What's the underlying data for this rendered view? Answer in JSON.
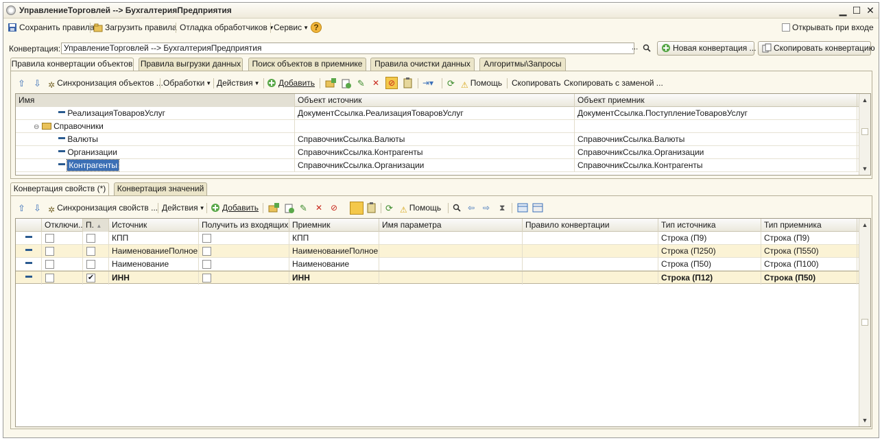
{
  "window": {
    "title": "УправлениеТорговлей --> БухгалтерияПредприятия",
    "minimize": "▁",
    "maximize": "☐",
    "close": "✕"
  },
  "toolbar": {
    "save_rules": "Сохранить правила",
    "load_rules": "Загрузить правила",
    "debug_handlers": "Отладка обработчиков",
    "service": "Сервис",
    "help_icon": "?",
    "open_on_login": "Открывать при входе"
  },
  "conversion": {
    "label": "Конвертация:",
    "value": "УправлениеТорговлей --> БухгалтерияПредприятия",
    "ellipsis": "...",
    "new_button": "Новая конвертация ...",
    "copy_button": "Скопировать конвертацию"
  },
  "top_tabs": [
    "Правила конвертации объектов",
    "Правила выгрузки данных",
    "Поиск объектов в приемнике",
    "Правила очистки данных",
    "Алгоритмы\\Запросы"
  ],
  "top_toolbar": {
    "sync": "Синхронизация объектов ...",
    "processing": "Обработки",
    "actions": "Действия",
    "add": "Добавить",
    "help": "Помощь",
    "copy": "Скопировать",
    "copy_replace": "Скопировать с заменой ..."
  },
  "top_grid": {
    "columns": [
      "Имя",
      "Объект источник",
      "Объект приемник"
    ],
    "rows": [
      {
        "name": "РеализацияТоваровУслуг",
        "source": "ДокументСсылка.РеализацияТоваровУслуг",
        "target": "ДокументСсылка.ПоступлениеТоваровУслуг"
      },
      {
        "name": "Справочники",
        "source": "",
        "target": ""
      },
      {
        "name": "Валюты",
        "source": "СправочникСсылка.Валюты",
        "target": "СправочникСсылка.Валюты"
      },
      {
        "name": "Организации",
        "source": "СправочникСсылка.Контрагенты",
        "target": "СправочникСсылка.Организации"
      },
      {
        "name": "Контрагенты",
        "source": "СправочникСсылка.Организации",
        "target": "СправочникСсылка.Контрагенты"
      }
    ]
  },
  "bottom_tabs": [
    "Конвертация свойств (*)",
    "Конвертация значений"
  ],
  "bottom_toolbar": {
    "sync": "Синхронизация свойств ...",
    "actions": "Действия",
    "add": "Добавить",
    "help": "Помощь"
  },
  "prop_grid": {
    "columns": [
      "Отключи...",
      "П.",
      "Источник",
      "Получить из входящих ...",
      "Приемник",
      "Имя параметра",
      "Правило конвертации",
      "Тип источника",
      "Тип приемника"
    ],
    "rows": [
      {
        "disabled": false,
        "p": false,
        "source": "КПП",
        "incoming": false,
        "target": "КПП",
        "param": "",
        "rule": "",
        "src_type": "Строка (П9)",
        "dst_type": "Строка (П9)",
        "bold": false
      },
      {
        "disabled": false,
        "p": false,
        "source": "НаименованиеПолное",
        "incoming": false,
        "target": "НаименованиеПолное",
        "param": "",
        "rule": "",
        "src_type": "Строка (П250)",
        "dst_type": "Строка (П550)",
        "bold": false
      },
      {
        "disabled": false,
        "p": false,
        "source": "Наименование",
        "incoming": false,
        "target": "Наименование",
        "param": "",
        "rule": "",
        "src_type": "Строка (П50)",
        "dst_type": "Строка (П100)",
        "bold": false
      },
      {
        "disabled": false,
        "p": true,
        "source": "ИНН",
        "incoming": false,
        "target": "ИНН",
        "param": "",
        "rule": "",
        "src_type": "Строка (П12)",
        "dst_type": "Строка (П50)",
        "bold": true
      }
    ]
  },
  "colors": {
    "window_bg": "#fbf8ec",
    "row_highlight": "#fbf3d5",
    "selection": "#3b6fb5"
  }
}
